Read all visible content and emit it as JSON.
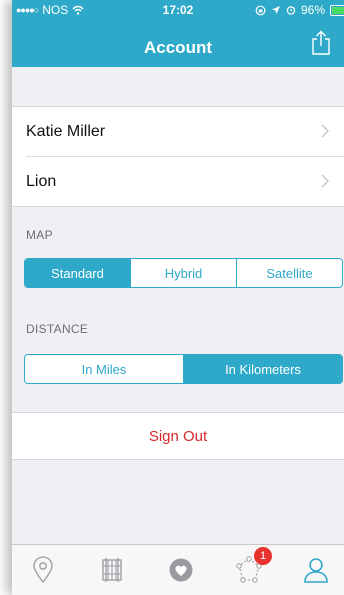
{
  "status_bar": {
    "carrier": "NOS",
    "time": "17:02",
    "battery": "96%",
    "battery_level": 0.96
  },
  "header": {
    "title": "Account",
    "share_icon": "share-icon"
  },
  "profile": {
    "items": [
      {
        "label": "Katie Miller"
      },
      {
        "label": "Lion"
      }
    ]
  },
  "map": {
    "section_label": "MAP",
    "options": [
      "Standard",
      "Hybrid",
      "Satellite"
    ],
    "selected": "Standard"
  },
  "distance": {
    "section_label": "DISTANCE",
    "options": [
      "In Miles",
      "In Kilometers"
    ],
    "selected": "In Kilometers"
  },
  "sign_out_label": "Sign Out",
  "tab_bar": {
    "tabs": [
      {
        "icon": "location-pin-icon"
      },
      {
        "icon": "route-grid-icon"
      },
      {
        "icon": "heart-icon"
      },
      {
        "icon": "network-icon",
        "badge": "1"
      },
      {
        "icon": "user-icon",
        "active": true
      }
    ]
  },
  "colors": {
    "accent": "#2fa9c9",
    "destructive": "#d9262c",
    "badge": "#e8322e",
    "background": "#efeff4"
  }
}
